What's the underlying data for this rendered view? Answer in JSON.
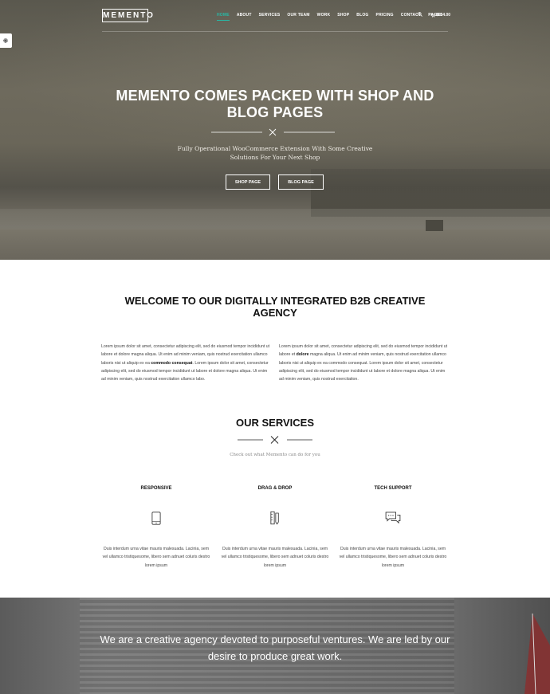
{
  "header": {
    "logo": "MEMENTO",
    "nav": [
      "HOME",
      "ABOUT",
      "SERVICES",
      "OUR TEAM",
      "WORK",
      "SHOP",
      "BLOG",
      "PRICING",
      "CONTACT",
      "PAGES"
    ],
    "active_nav": "HOME",
    "cart_total": "$634.00"
  },
  "hero": {
    "title": "MEMENTO COMES PACKED WITH SHOP AND BLOG PAGES",
    "subtitle": "Fully Operational WooCommerce Extension With Some Creative Solutions For Your Next Shop",
    "buttons": [
      "SHOP PAGE",
      "BLOG PAGE"
    ]
  },
  "welcome": {
    "title": "WELCOME TO OUR DIGITALLY INTEGRATED B2B CREATIVE AGENCY",
    "para_left_1": "Lorem ipsum dolor sit amet, consectetur adipiscing elit, sed do eiusmod tempor incididunt ut labore et dolore magna aliqua. Ut enim ad minim veniam, quis nostrud exercitation ullamco laboris nisi ut aliquip ex ea ",
    "para_left_bold": "commodo consequat",
    "para_left_2": ". Lorem ipsum dolor sit amet, consectetur adipiscing elit, sed do eiusmod tempor incididunt ut labore et dolore magna aliqua. Ut enim ad minim veniam, quis nostrud exercitation ullamco labo.",
    "para_right_1": "Lorem ipsum dolor sit amet, consectetur adipiscing elit, sed do eiusmod tempor incididunt ut labore et ",
    "para_right_bold": "dolore",
    "para_right_2": " magna aliqua. Ut enim ad minim veniam, quis nostrud exercitation ullamco laboris nisi ut aliquip ex ea commodo consequat. Lorem ipsum dolor sit amet, consectetur adipiscing elit, sed do eiusmod tempor incididunt ut labore et dolore magna aliqua. Ut enim ad minim veniam, quis nostrud exercitation."
  },
  "services": {
    "title": "OUR SERVICES",
    "subtitle": "Check out what Memento can do for you",
    "items": [
      {
        "title": "RESPONSIVE",
        "icon": "tablet-icon",
        "text": "Duis interdum urna vitae mauris malesuada. Lacinia, sem vel ullamco tristiquesome, libero sem adnuet coluris destro lorem ipsum"
      },
      {
        "title": "DRAG & DROP",
        "icon": "pencil-ruler-icon",
        "text": "Duis interdum urna vitae mauris malesuada. Lacinia, sem vel ullamco tristiquesome, libero sem adnuet coluris destro lorem ipsum"
      },
      {
        "title": "TECH SUPPORT",
        "icon": "chat-bubbles-icon",
        "text": "Duis interdum urna vitae mauris malesuada. Lacinia, sem vel ullamco tristiquesome, libero sem adnuet coluris destro lorem ipsum"
      }
    ]
  },
  "quote": {
    "text": "We are a creative agency devoted to purposeful ventures. We are led by our desire to produce great work."
  },
  "colors": {
    "accent": "#28b9a6",
    "hero_bg": "#6a665a",
    "quote_bg": "#707070"
  },
  "icons": [
    "gear-icon",
    "search-icon",
    "cart-icon",
    "tablet-icon",
    "pencil-ruler-icon",
    "chat-bubbles-icon",
    "x-divider-icon"
  ]
}
